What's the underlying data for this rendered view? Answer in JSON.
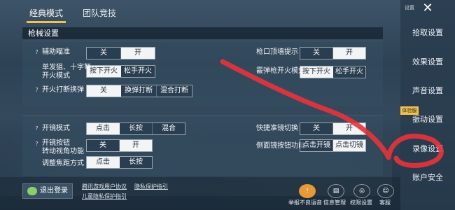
{
  "tabs": [
    "经典模式",
    "团队竞技"
  ],
  "section_title": "枪械设置",
  "top_panel": {
    "aim_assist": {
      "label": "辅助瞄准",
      "options": [
        "关",
        "开"
      ],
      "selected": 1
    },
    "single_fire": {
      "label_line1": "单发狙、十字弩",
      "label_line2": "开火模式",
      "options": [
        "按下开火",
        "松手开火"
      ],
      "selected": 0
    },
    "fire_switch": {
      "label": "开火打断换弹",
      "options": [
        "关",
        "换弹打断",
        "混合打断"
      ],
      "selected": 0
    },
    "muzzle_hint": {
      "label": "枪口顶墙提示",
      "options": [
        "关",
        "开"
      ],
      "selected": 1
    },
    "shotgun_fire": {
      "label": "霰弹枪开火模式",
      "options": [
        "按下开火",
        "松手开火"
      ],
      "selected": 0
    }
  },
  "bottom_panel": {
    "scope_mode": {
      "label": "开镜模式",
      "options": [
        "点击",
        "长按",
        "混合"
      ],
      "selected": 0
    },
    "scope_button": {
      "label_line1": "开镜按钮",
      "label_line2": "转动视角功能",
      "options": [
        "关",
        "开"
      ],
      "selected": 1
    },
    "focus_mode": {
      "label": "调整焦距方式",
      "options": [
        "点击",
        "长按"
      ],
      "selected": 0
    },
    "quick_scope": {
      "label": "快捷准镜切换",
      "options": [
        "关",
        "开"
      ],
      "selected": 1
    },
    "side_scope": {
      "label": "侧面镜按钮功能",
      "options": [
        "点击开镜",
        "点击切镜"
      ],
      "selected": 1
    }
  },
  "sidebar": {
    "header": "设置",
    "items": [
      "拾取设置",
      "效果设置",
      "声音设置",
      "振动设置",
      "录像设置",
      "账户安全"
    ],
    "tag": "体验服"
  },
  "bottom": {
    "logout": "退出登录",
    "links": [
      "腾讯游戏用户协议",
      "隐私保护指引",
      "儿童隐私保护指引"
    ],
    "actions": [
      "举报不良语音",
      "信息管理",
      "权限设置",
      "客服"
    ]
  },
  "colors": {
    "accent": "#f2c14e",
    "annotation": "#e8333a"
  }
}
